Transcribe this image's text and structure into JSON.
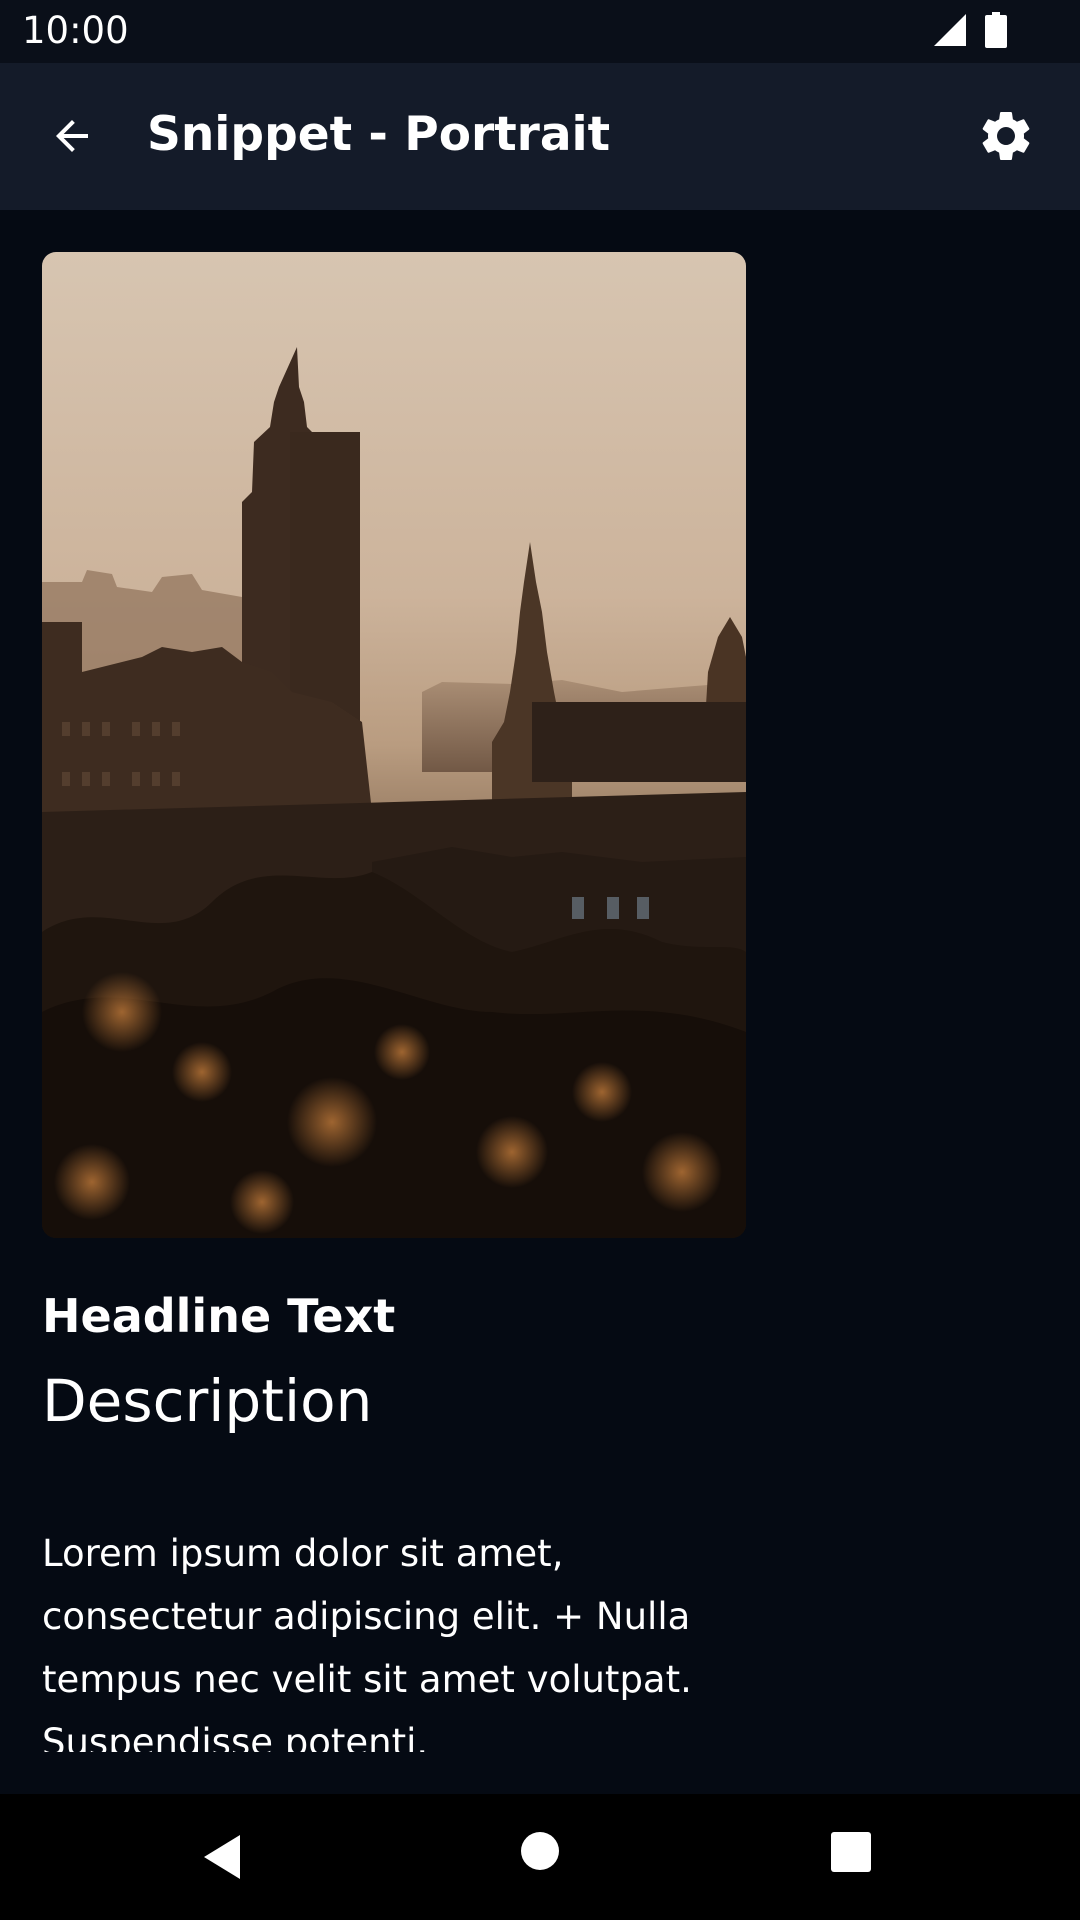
{
  "status_bar": {
    "time": "10:00",
    "icons": [
      "signal-icon",
      "battery-icon"
    ]
  },
  "app_bar": {
    "title": "Snippet - Portrait",
    "back_icon": "arrow-back-icon",
    "settings_icon": "gear-icon"
  },
  "card": {
    "image_subject": "city-skyline-clock-tower-photo"
  },
  "content": {
    "headline": "Headline Text",
    "description": "Description",
    "body": "Lorem ipsum dolor sit amet, consectetur adipiscing elit. + Nulla tempus nec velit sit amet volutpat. Suspendisse potenti."
  },
  "nav_bar": {
    "icons": [
      "nav-back-icon",
      "nav-home-icon",
      "nav-recents-icon"
    ]
  },
  "colors": {
    "background": "#050a13",
    "status_bar": "#0a0f19",
    "app_bar": "#141b29",
    "nav_bar": "#000000",
    "text": "#ffffff"
  }
}
